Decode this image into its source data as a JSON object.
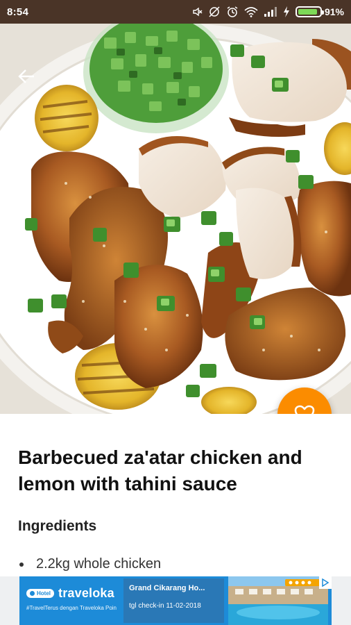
{
  "status_bar": {
    "time": "8:54",
    "battery_percent": "91%",
    "battery_level": 0.91,
    "icons": [
      "mute-icon",
      "alarm-off-icon",
      "alarm-icon",
      "wifi-icon",
      "signal-icon",
      "charging-icon",
      "battery-icon"
    ]
  },
  "hero": {
    "image_name": "barbecued-chicken-photo",
    "back_icon": "arrow-back-icon",
    "favorite_icon": "heart-outline-icon",
    "accent_color": "#fb8c00"
  },
  "recipe": {
    "title": "Barbecued za'atar chicken and lemon with tahini sauce",
    "ingredients_heading": "Ingredients",
    "ingredients": [
      "2.2kg whole chicken"
    ]
  },
  "ad": {
    "brand": "traveloka",
    "badge": "Hotel",
    "tagline": "#TravelTerus dengan Traveloka Poin",
    "hotel_name": "Grand Cikarang Ho...",
    "checkin": "tgl check-in 11-02-2018",
    "info_icon": "ad-choices-icon"
  }
}
